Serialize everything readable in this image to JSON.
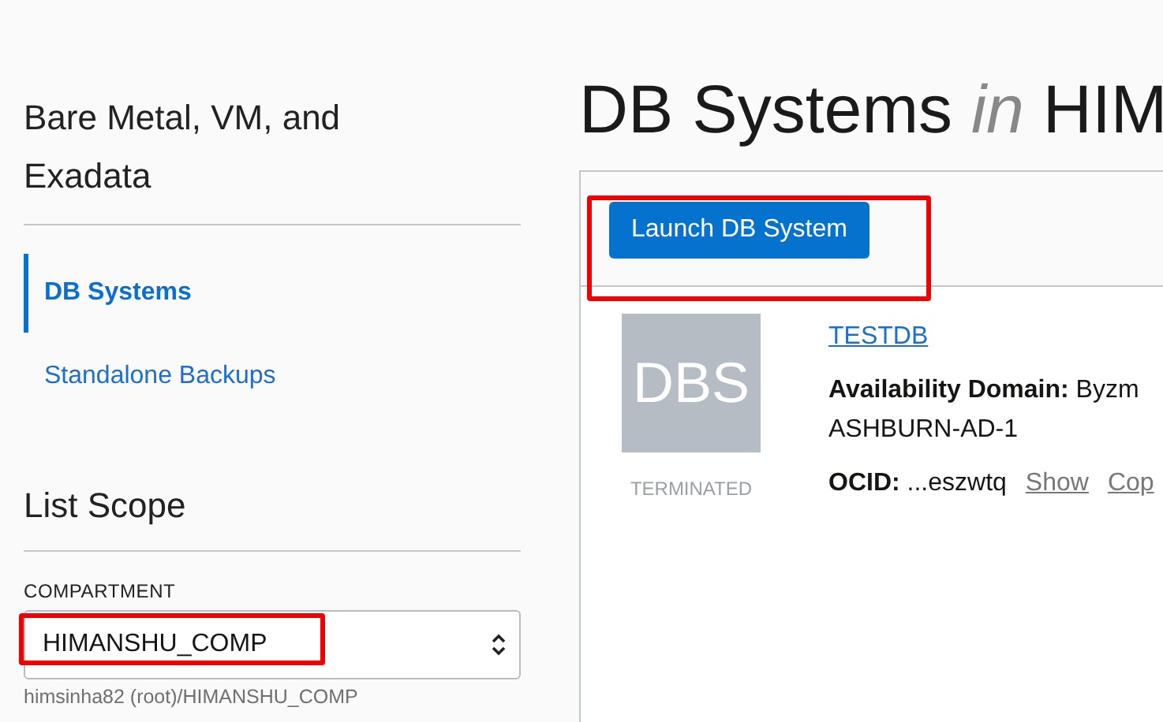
{
  "sidebar": {
    "title": "Bare Metal, VM, and Exadata",
    "nav": [
      {
        "label": "DB Systems",
        "selected": true
      },
      {
        "label": "Standalone Backups",
        "selected": false
      }
    ],
    "scope": {
      "title": "List Scope",
      "compartment": {
        "label": "COMPARTMENT",
        "value": "HIMANSHU_COMP",
        "highlighted": true,
        "path": "himsinha82 (root)/HIMANSHU_COMP"
      }
    }
  },
  "main": {
    "heading": {
      "prefix": "DB Systems",
      "connector": "in",
      "suffix": "HIM"
    },
    "launch_button": {
      "label": "Launch DB System",
      "highlighted": true
    },
    "rows": [
      {
        "badge": "DBS",
        "state": "TERMINATED",
        "name": "TESTDB",
        "fields": [
          {
            "label": "Availability Domain:",
            "value": "Byzm",
            "continued": "ASHBURN-AD-1"
          },
          {
            "label": "OCID:",
            "value": "...eszwtq",
            "links": [
              "Show",
              "Cop"
            ]
          }
        ]
      }
    ]
  }
}
